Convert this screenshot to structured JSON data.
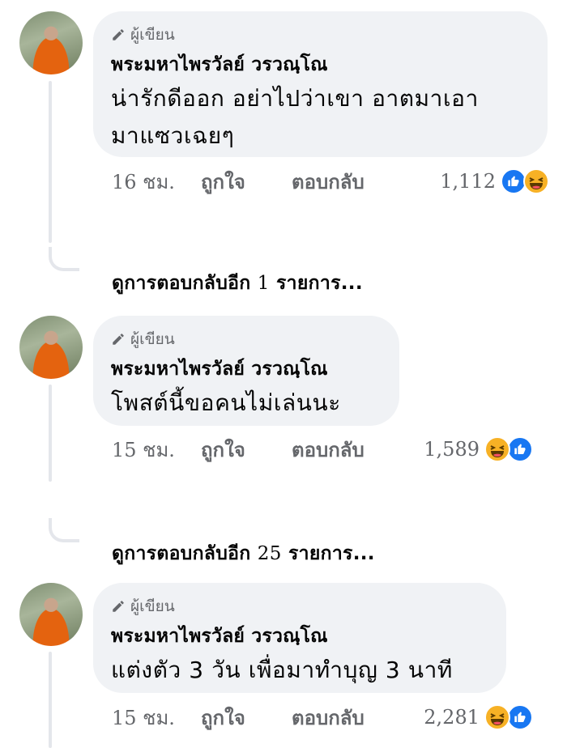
{
  "comments": [
    {
      "author_badge": "ผู้เขียน",
      "name": "พระมหาไพรวัลย์ วรวณฺโณ",
      "text_lines": [
        "น่ารักดีออก อย่าไปว่าเขา อาตมาเอา",
        "มาแซวเฉยๆ"
      ],
      "time": "16 ชม.",
      "like_label": "ถูกใจ",
      "reply_label": "ตอบกลับ",
      "reaction_count": "1,112",
      "reactions": [
        "like-icon",
        "haha-icon"
      ]
    },
    {
      "author_badge": "ผู้เขียน",
      "name": "พระมหาไพรวัลย์ วรวณฺโณ",
      "text_lines": [
        "โพสต์นี้ขอคนไม่เล่นนะ"
      ],
      "time": "15 ชม.",
      "like_label": "ถูกใจ",
      "reply_label": "ตอบกลับ",
      "reaction_count": "1,589",
      "reactions": [
        "haha-icon",
        "like-icon"
      ]
    },
    {
      "author_badge": "ผู้เขียน",
      "name": "พระมหาไพรวัลย์ วรวณฺโณ",
      "text_lines": [
        "แต่งตัว 3 วัน เพื่อมาทำบุญ 3 นาที"
      ],
      "time": "15 ชม.",
      "like_label": "ถูกใจ",
      "reply_label": "ตอบกลับ",
      "reaction_count": "2,281",
      "reactions": [
        "haha-icon",
        "like-icon"
      ]
    }
  ],
  "more_replies": [
    {
      "prefix": "ดูการตอบกลับอีก",
      "count": "1",
      "suffix": "รายการ..."
    },
    {
      "prefix": "ดูการตอบกลับอีก",
      "count": "25",
      "suffix": "รายการ..."
    }
  ],
  "colors": {
    "bubble": "#f0f2f5",
    "secondary_text": "#65676b",
    "like_blue": "#1877f2",
    "haha_yellow": "#f7b125",
    "robe_orange": "#e4630f"
  }
}
